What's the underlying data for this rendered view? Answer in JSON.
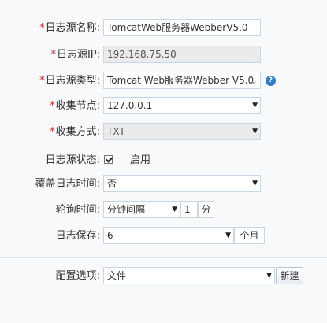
{
  "fields": {
    "log_source_name": {
      "label": "日志源名称:",
      "required": true,
      "value": "TomcatWeb服务器WebberV5.0"
    },
    "log_source_ip": {
      "label": "日志源IP:",
      "required": true,
      "value": "192.168.75.50"
    },
    "log_source_type": {
      "label": "日志源类型:",
      "required": true,
      "value": "Tomcat Web服务器Webber V5.0"
    },
    "collection_node": {
      "label": "收集节点:",
      "required": true,
      "value": "127.0.0.1"
    },
    "collection_method": {
      "label": "收集方式:",
      "required": true,
      "value": "TXT"
    },
    "log_source_status": {
      "label": "日志源状态:",
      "required": false,
      "checked": true,
      "value": "启用"
    },
    "overwrite_log_time": {
      "label": "覆盖日志时间:",
      "required": false,
      "value": "否"
    },
    "poll_time": {
      "label": "轮询时间:",
      "required": false,
      "value": "分钟间隔",
      "count": "1",
      "unit": "分"
    },
    "log_retention": {
      "label": "日志保存:",
      "required": false,
      "value": "6",
      "unit": "个月"
    },
    "config_option": {
      "label": "配置选项:",
      "required": false,
      "value": "文件",
      "button": "新建"
    }
  },
  "symbols": {
    "required_mark": "*",
    "help": "?"
  },
  "icons": [
    "caret-down-icon",
    "chevron-down-icon",
    "help-icon",
    "checkbox-checked-icon"
  ],
  "colors": {
    "required": "#e02020",
    "help": "#2e7dd1",
    "border": "#c8d6e5",
    "disabled_bg": "#ebebeb"
  }
}
